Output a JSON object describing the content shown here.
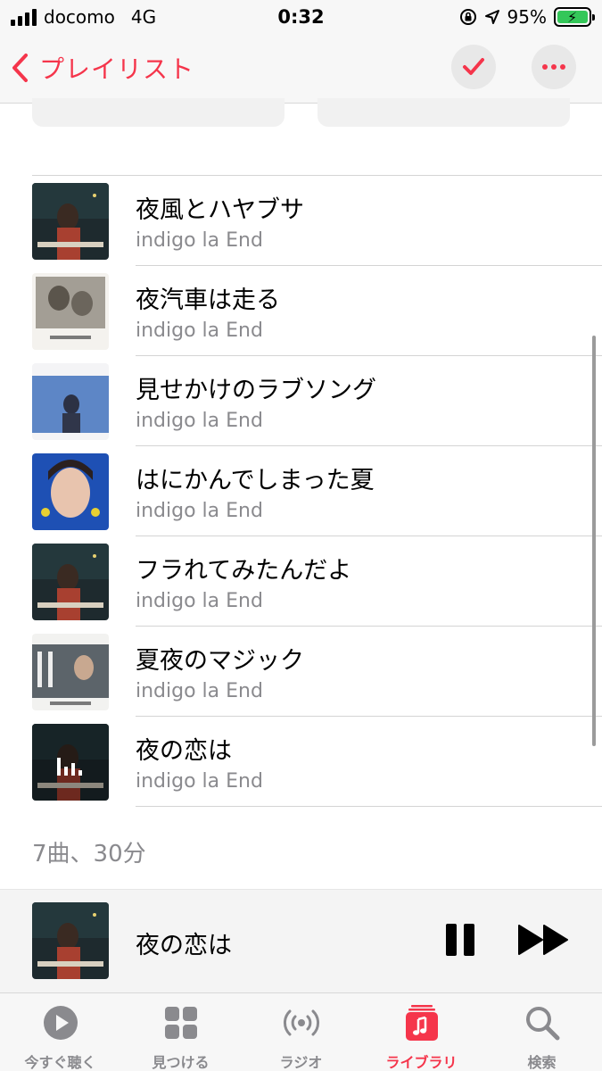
{
  "status_bar": {
    "carrier": "docomo",
    "network": "4G",
    "time": "0:32",
    "battery": "95%"
  },
  "nav": {
    "back_label": "プレイリスト"
  },
  "tracks": [
    {
      "title": "夜風とハヤブサ",
      "artist": "indigo la End",
      "art": "secret-de-nuit-art"
    },
    {
      "title": "夜汽車は走る",
      "artist": "indigo la End",
      "art": "indigo-la-end-album-art"
    },
    {
      "title": "見せかけのラブソング",
      "artist": "indigo la End",
      "art": "blue-sky-art"
    },
    {
      "title": "はにかんでしまった夏",
      "artist": "indigo la End",
      "art": "portrait-blue-art"
    },
    {
      "title": "フラれてみたんだよ",
      "artist": "indigo la End",
      "art": "secret-de-nuit-art"
    },
    {
      "title": "夏夜のマジック",
      "artist": "indigo la End",
      "art": "natsuyoru-art"
    },
    {
      "title": "夜の恋は",
      "artist": "indigo la End",
      "art": "secret-de-nuit-art",
      "playing": true
    }
  ],
  "summary": "7曲、30分",
  "mini_player": {
    "title": "夜の恋は"
  },
  "tabs": [
    {
      "label": "今すぐ聴く",
      "icon": "play-circle-icon"
    },
    {
      "label": "見つける",
      "icon": "grid-icon"
    },
    {
      "label": "ラジオ",
      "icon": "radio-icon"
    },
    {
      "label": "ライブラリ",
      "icon": "library-icon",
      "active": true
    },
    {
      "label": "検索",
      "icon": "search-icon"
    }
  ],
  "colors": {
    "accent": "#f5354b",
    "secondary_text": "#8a8a8e",
    "battery_green": "#34c759"
  }
}
